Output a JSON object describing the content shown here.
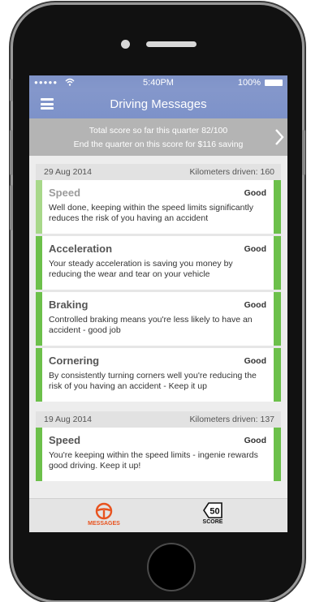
{
  "status_bar": {
    "signal": "●●●●●",
    "time": "5:40PM",
    "battery": "100%"
  },
  "nav": {
    "title": "Driving Messages"
  },
  "banner": {
    "line1": "Total score so far this quarter 82/100",
    "line2": "End the quarter on this score for $116 saving"
  },
  "days": [
    {
      "date": "29 Aug 2014",
      "km": "Kilometers driven: 160",
      "messages": [
        {
          "title": "Speed",
          "rating": "Good",
          "text": "Well done, keeping within the speed limits significantly reduces the risk of you having an accident"
        },
        {
          "title": "Acceleration",
          "rating": "Good",
          "text": "Your steady acceleration is saving you money by reducing the wear and tear on your vehicle"
        },
        {
          "title": "Braking",
          "rating": "Good",
          "text": "Controlled braking means you're less likely to have an accident - good job"
        },
        {
          "title": "Cornering",
          "rating": "Good",
          "text": "By consistently turning corners well you're reducing the risk of you having an accident - Keep it up"
        }
      ]
    },
    {
      "date": "19 Aug 2014",
      "km": "Kilometers driven: 137",
      "messages": [
        {
          "title": "Speed",
          "rating": "Good",
          "text": "You're keeping within the speed limits - ingenie rewards good driving. Keep it up!"
        }
      ]
    }
  ],
  "tabs": {
    "messages_label": "MESSAGES",
    "score_label": "SCORE",
    "score_value": "50"
  },
  "colors": {
    "nav": "#8497cb",
    "banner": "#b4b4b4",
    "good_bar": "#6cc04a",
    "active_tab": "#e8531f"
  },
  "icons": {
    "menu": "hamburger-icon",
    "banner_chevron": "chevron-right-icon",
    "messages_tab": "steering-wheel-icon",
    "score_tab": "speed-sign-icon"
  }
}
